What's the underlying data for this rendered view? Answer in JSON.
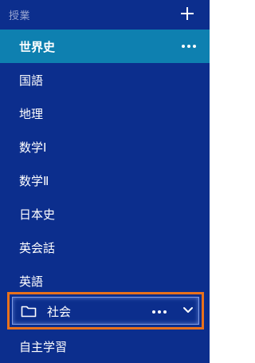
{
  "sidebar": {
    "header": {
      "title": "授業",
      "add_icon": "plus-icon"
    },
    "items": [
      {
        "label": "世界史",
        "active": true,
        "more_icon": "ellipsis-icon"
      },
      {
        "label": "国語"
      },
      {
        "label": "地理"
      },
      {
        "label": "数学Ⅰ"
      },
      {
        "label": "数学Ⅱ"
      },
      {
        "label": "日本史"
      },
      {
        "label": "英会話"
      },
      {
        "label": "英語"
      }
    ],
    "folder": {
      "label": "社会",
      "icon": "folder-icon",
      "more_icon": "ellipsis-icon",
      "toggle_icon": "chevron-down-icon",
      "highlight_color": "#e8711c"
    },
    "after_folder": [
      {
        "label": "自主学習"
      }
    ]
  },
  "colors": {
    "panel_bg": "#0c2e8d",
    "active_bg": "#0e80b0",
    "header_text": "#9aa7d2"
  }
}
